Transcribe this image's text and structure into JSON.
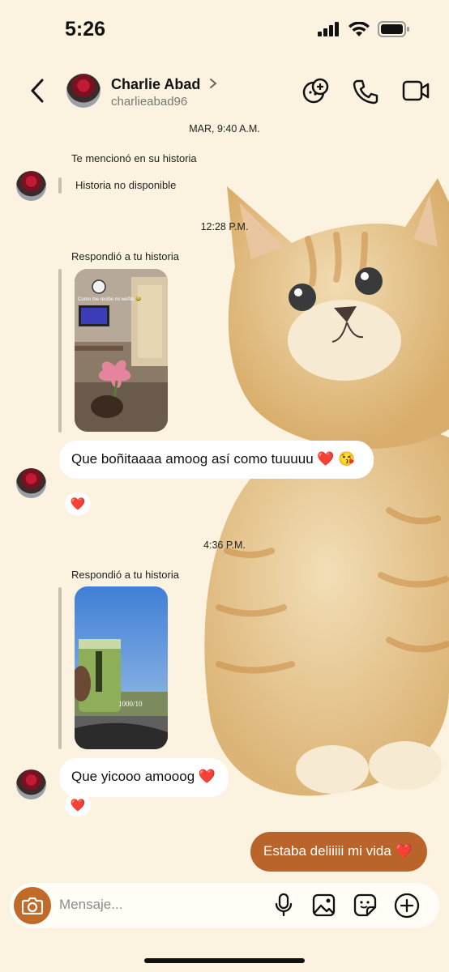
{
  "status_bar": {
    "time": "5:26"
  },
  "header": {
    "contact_name": "Charlie Abad",
    "username": "charlieabad96"
  },
  "messages": {
    "ts1": "MAR, 9:40 A.M.",
    "mention_label": "Te mencionó en su historia",
    "story_unavailable": "Historia no disponible",
    "ts2": "12:28 P.M.",
    "reply1_label": "Respondió a tu historia",
    "story1_caption": "Como me recibe mi weñto 😂",
    "msg1": "Que boñitaaaa amoog así como tuuuuu ❤️ 😘",
    "reaction1": "❤️",
    "ts3": "4:36 P.M.",
    "reply2_label": "Respondió a tu historia",
    "story2_caption": "1000/10",
    "msg2": "Que yicooo amooog ❤️",
    "reaction2": "❤️",
    "sent_msg": "Estaba deliiiii mi vida ❤️"
  },
  "composer": {
    "placeholder": "Mensaje..."
  },
  "colors": {
    "background": "#fbf3df",
    "sent_bubble": "#b8642a",
    "camera_button": "#c16b2b"
  }
}
